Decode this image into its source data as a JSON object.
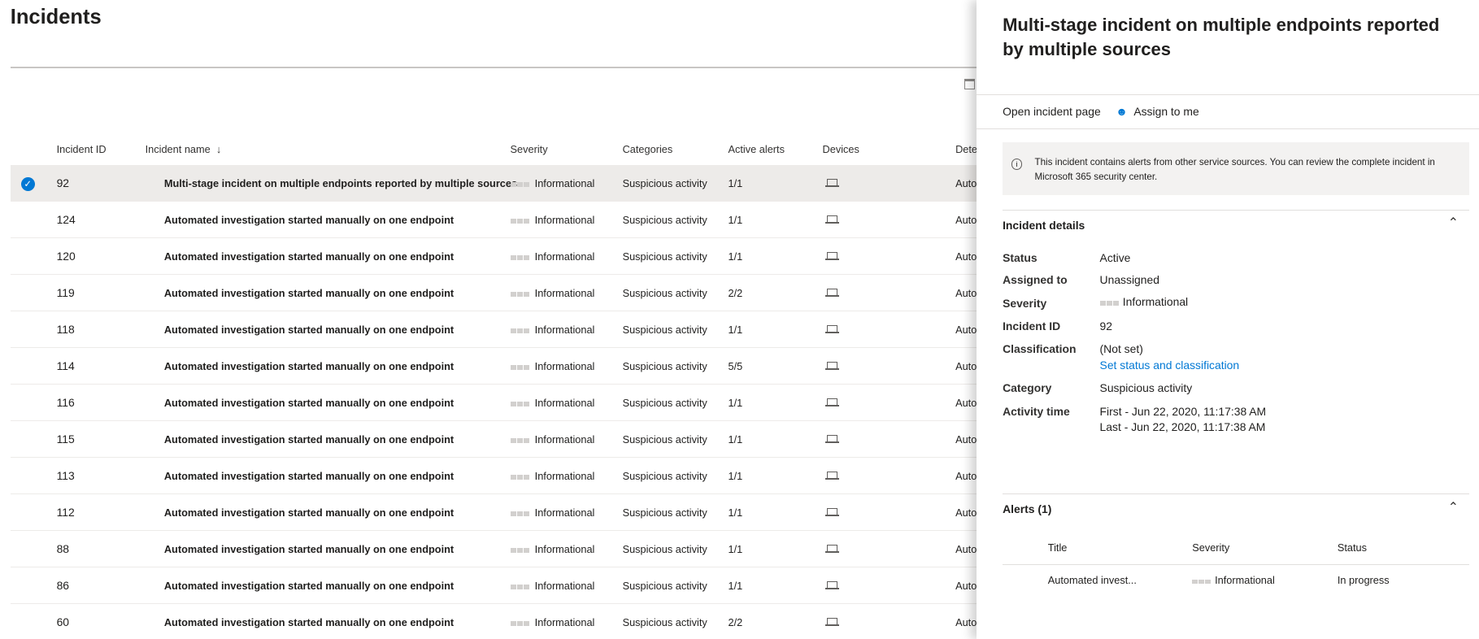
{
  "page": {
    "title": "Incidents"
  },
  "table": {
    "headers": {
      "id": "Incident ID",
      "name": "Incident name",
      "sort_icon": "↓",
      "severity": "Severity",
      "categories": "Categories",
      "active_alerts": "Active alerts",
      "devices": "Devices",
      "detection": "Dete"
    },
    "rows": [
      {
        "id": "92",
        "name": "Multi-stage incident on multiple endpoints reported by multiple sources",
        "severity": "Informational",
        "category": "Suspicious activity",
        "alerts": "1/1",
        "detection": "Auto",
        "selected": true
      },
      {
        "id": "124",
        "name": "Automated investigation started manually on one endpoint",
        "severity": "Informational",
        "category": "Suspicious activity",
        "alerts": "1/1",
        "detection": "Auto"
      },
      {
        "id": "120",
        "name": "Automated investigation started manually on one endpoint",
        "severity": "Informational",
        "category": "Suspicious activity",
        "alerts": "1/1",
        "detection": "Auto"
      },
      {
        "id": "119",
        "name": "Automated investigation started manually on one endpoint",
        "severity": "Informational",
        "category": "Suspicious activity",
        "alerts": "2/2",
        "detection": "Auto"
      },
      {
        "id": "118",
        "name": "Automated investigation started manually on one endpoint",
        "severity": "Informational",
        "category": "Suspicious activity",
        "alerts": "1/1",
        "detection": "Auto"
      },
      {
        "id": "114",
        "name": "Automated investigation started manually on one endpoint",
        "severity": "Informational",
        "category": "Suspicious activity",
        "alerts": "5/5",
        "detection": "Auto"
      },
      {
        "id": "116",
        "name": "Automated investigation started manually on one endpoint",
        "severity": "Informational",
        "category": "Suspicious activity",
        "alerts": "1/1",
        "detection": "Auto"
      },
      {
        "id": "115",
        "name": "Automated investigation started manually on one endpoint",
        "severity": "Informational",
        "category": "Suspicious activity",
        "alerts": "1/1",
        "detection": "Auto"
      },
      {
        "id": "113",
        "name": "Automated investigation started manually on one endpoint",
        "severity": "Informational",
        "category": "Suspicious activity",
        "alerts": "1/1",
        "detection": "Auto"
      },
      {
        "id": "112",
        "name": "Automated investigation started manually on one endpoint",
        "severity": "Informational",
        "category": "Suspicious activity",
        "alerts": "1/1",
        "detection": "Auto"
      },
      {
        "id": "88",
        "name": "Automated investigation started manually on one endpoint",
        "severity": "Informational",
        "category": "Suspicious activity",
        "alerts": "1/1",
        "detection": "Auto"
      },
      {
        "id": "86",
        "name": "Automated investigation started manually on one endpoint",
        "severity": "Informational",
        "category": "Suspicious activity",
        "alerts": "1/1",
        "detection": "Auto"
      },
      {
        "id": "60",
        "name": "Automated investigation started manually on one endpoint",
        "severity": "Informational",
        "category": "Suspicious activity",
        "alerts": "2/2",
        "detection": "Auto"
      }
    ]
  },
  "panel": {
    "title": "Multi-stage incident on multiple endpoints reported by multiple sources",
    "open_incident": "Open incident page",
    "assign": "Assign to me",
    "info": "This incident contains alerts from other service sources. You can review the complete incident in Microsoft 365 security center.",
    "details_title": "Incident details",
    "details": {
      "status_label": "Status",
      "status": "Active",
      "assigned_label": "Assigned to",
      "assigned": "Unassigned",
      "severity_label": "Severity",
      "severity": "Informational",
      "id_label": "Incident ID",
      "id": "92",
      "class_label": "Classification",
      "class": "(Not set)",
      "class_link": "Set status and classification",
      "category_label": "Category",
      "category": "Suspicious activity",
      "time_label": "Activity time",
      "first": "First - Jun 22, 2020, 11:17:38 AM",
      "last": "Last - Jun 22, 2020, 11:17:38 AM"
    },
    "alerts_title": "Alerts (1)",
    "alerts": {
      "h_title": "Title",
      "h_sev": "Severity",
      "h_status": "Status",
      "title": "Automated invest...",
      "severity": "Informational",
      "status": "In progress"
    }
  }
}
